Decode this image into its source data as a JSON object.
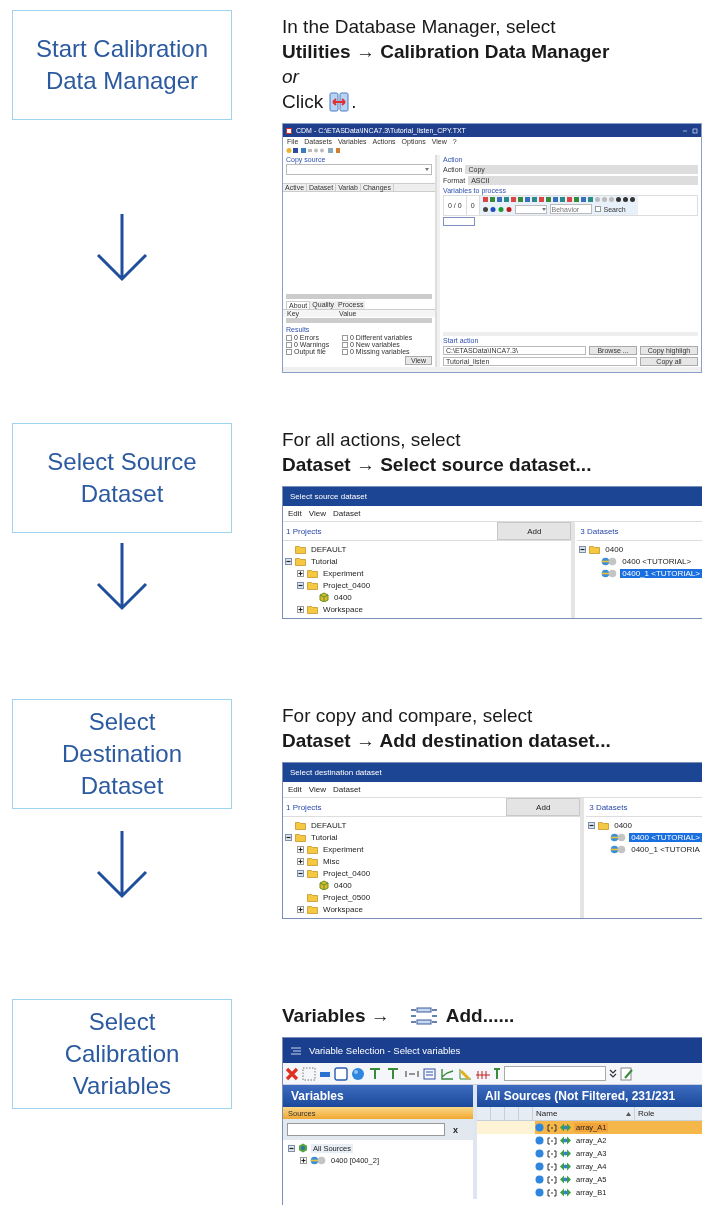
{
  "steps": [
    {
      "label": "Start Calibration\nData Manager",
      "instructions": [
        {
          "kind": "plain",
          "text": "In the Database Manager, select"
        },
        {
          "kind": "bold",
          "text": "Utilities → Calibration Data Manager"
        },
        {
          "kind": "italic",
          "text": "or"
        },
        {
          "kind": "click_icon",
          "text": "Click",
          "after": "."
        }
      ],
      "screenshot": {
        "kind": "cdm",
        "title": "CDM - C:\\ETASData\\INCA7.3\\Tutorial_listen_CPY.TXT",
        "menu": [
          "File",
          "Datasets",
          "Variables",
          "Actions",
          "Options",
          "View",
          "?"
        ],
        "copy_source": "Copy source",
        "source_columns": [
          "Active",
          "Dataset",
          "Variab",
          "Changes"
        ],
        "tabs": [
          {
            "label": "About",
            "selected": true
          },
          {
            "label": "Quality",
            "selected": false
          },
          {
            "label": "Process",
            "selected": false
          }
        ],
        "info_columns": [
          "Key",
          "Value"
        ],
        "results_title": "Results",
        "results": [
          {
            "label": "0 Errors",
            "checked": false
          },
          {
            "label": "0 Different variables",
            "checked": false
          },
          {
            "label": "0 Warnings",
            "checked": false
          },
          {
            "label": "0 New variables",
            "checked": false
          },
          {
            "label": "Output file",
            "checked": false
          },
          {
            "label": "0 Missing variables",
            "checked": false
          }
        ],
        "view_button": "View",
        "action_title": "Action",
        "fields": [
          {
            "label": "Action",
            "value": "Copy"
          },
          {
            "label": "Format",
            "value": "ASCII"
          }
        ],
        "variables_title": "Variables to process",
        "counts": [
          "0 / 0",
          "0"
        ],
        "behavior_placeholder": "Behavior",
        "search_label": "Search",
        "search_checked": false,
        "start_title": "Start action",
        "path": "C:\\ETASData\\INCA7.3\\",
        "browse_button": "Browse ...",
        "file_name": "Tutorial_listen",
        "action_buttons": [
          "Copy highligh",
          "Copy all"
        ]
      }
    },
    {
      "label": "Select Source\nDataset",
      "instructions": [
        {
          "kind": "plain",
          "text": "For all actions, select"
        },
        {
          "kind": "bold",
          "text": "Dataset → Select source dataset..."
        }
      ],
      "screenshot": {
        "kind": "dataset_dialog",
        "title": "Select source dataset",
        "menu": [
          "Edit",
          "View",
          "Dataset"
        ],
        "projects_title": "1 Projects",
        "add_button": "Add",
        "projects": [
          {
            "label": "DEFAULT",
            "kind": "folder",
            "selected": false
          },
          {
            "label": "Tutorial",
            "kind": "folder",
            "expanded": true,
            "selected": false,
            "children": [
              {
                "label": "Experiment",
                "kind": "folder",
                "expanded": false,
                "selected": false
              },
              {
                "label": "Project_0400",
                "kind": "folder",
                "expanded": true,
                "selected": false,
                "children": [
                  {
                    "label": "0400",
                    "kind": "project",
                    "selected": false
                  }
                ]
              },
              {
                "label": "Workspace",
                "kind": "folder",
                "expanded": false,
                "selected": false
              }
            ]
          }
        ],
        "datasets_title": "3 Datasets",
        "datasets": [
          {
            "label": "0400",
            "kind": "folder",
            "expanded": true,
            "selected": false,
            "children": [
              {
                "label": "0400 <TUTORIAL>",
                "kind": "dataset",
                "selected": false
              },
              {
                "label": "0400_1 <TUTORIAL>",
                "kind": "dataset",
                "selected": true
              }
            ]
          }
        ]
      }
    },
    {
      "label": "Select\nDestination\nDataset",
      "instructions": [
        {
          "kind": "plain",
          "text": "For copy and compare, select"
        },
        {
          "kind": "bold",
          "text": "Dataset → Add destination dataset..."
        }
      ],
      "screenshot": {
        "kind": "dataset_dialog",
        "title": "Select destination dataset",
        "menu": [
          "Edit",
          "View",
          "Dataset"
        ],
        "projects_title": "1 Projects",
        "add_button": "Add",
        "projects": [
          {
            "label": "DEFAULT",
            "kind": "folder",
            "selected": false
          },
          {
            "label": "Tutorial",
            "kind": "folder",
            "expanded": true,
            "selected": false,
            "children": [
              {
                "label": "Experiment",
                "kind": "folder",
                "expanded": false,
                "selected": false
              },
              {
                "label": "Misc",
                "kind": "folder",
                "expanded": false,
                "selected": false
              },
              {
                "label": "Project_0400",
                "kind": "folder",
                "expanded": true,
                "selected": false,
                "children": [
                  {
                    "label": "0400",
                    "kind": "project",
                    "selected": false
                  }
                ]
              },
              {
                "label": "Project_0500",
                "kind": "folder",
                "selected": false
              },
              {
                "label": "Workspace",
                "kind": "folder",
                "expanded": false,
                "selected": false
              }
            ]
          }
        ],
        "datasets_title": "3 Datasets",
        "datasets": [
          {
            "label": "0400",
            "kind": "folder",
            "expanded": true,
            "selected": false,
            "children": [
              {
                "label": "0400 <TUTORIAL>",
                "kind": "dataset",
                "selected": true
              },
              {
                "label": "0400_1 <TUTORIA",
                "kind": "dataset",
                "selected": false
              }
            ]
          }
        ]
      }
    },
    {
      "label": "Select\nCalibration\nVariables",
      "instructions": [
        {
          "kind": "menu_icon",
          "text": "Variables →",
          "after": "Add......"
        }
      ],
      "screenshot": {
        "kind": "variable_selection",
        "title": "Variable Selection - Select variables",
        "left_title": "Variables",
        "sources_title": "Sources",
        "clear_button": "x",
        "sources": [
          {
            "label": "All Sources",
            "kind": "all",
            "expanded": true,
            "selected": true,
            "children": [
              {
                "label": "0400 [0400_2]",
                "kind": "dataset",
                "expanded": false,
                "selected": false
              }
            ]
          }
        ],
        "right_title": "All Sources (Not Filtered, 231/231",
        "columns": [
          "Name",
          "Role"
        ],
        "rows": [
          {
            "name": "array_A1",
            "selected": true
          },
          {
            "name": "array_A2",
            "selected": false
          },
          {
            "name": "array_A3",
            "selected": false
          },
          {
            "name": "array_A4",
            "selected": false
          },
          {
            "name": "array_A5",
            "selected": false
          },
          {
            "name": "array_B1",
            "selected": false
          }
        ]
      }
    }
  ]
}
